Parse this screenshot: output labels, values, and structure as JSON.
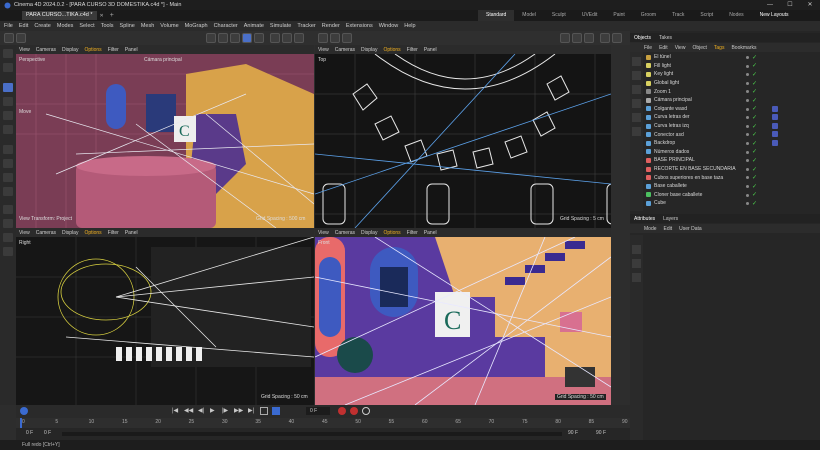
{
  "window": {
    "title": "Cinema 4D 2024.0.2 - [PARA CURSO 3D DOMESTIKA.c4d *] - Main",
    "doc_tab": "PARA CURSO...TIKA.c4d *"
  },
  "layouts": [
    "Standard",
    "Model",
    "Sculpt",
    "UVEdit",
    "Paint",
    "Groom",
    "Track",
    "Script",
    "Nodes",
    "New Layouts"
  ],
  "menu": [
    "File",
    "Edit",
    "Create",
    "Modes",
    "Select",
    "Tools",
    "Spline",
    "Mesh",
    "Volume",
    "MoGraph",
    "Character",
    "Animate",
    "Simulate",
    "Tracker",
    "Render",
    "Extensions",
    "Window",
    "Help"
  ],
  "viewport_menu": [
    "View",
    "Cameras",
    "Display",
    "Options",
    "Filter",
    "Panel"
  ],
  "viewports": {
    "perspective": {
      "label": "Perspective",
      "camera": "Cámara principal",
      "hud": "View Transform: Project",
      "grid": "Grid Spacing : 500 cm"
    },
    "top": {
      "label": "Top",
      "grid": "Grid Spacing : 5 cm"
    },
    "right": {
      "label": "Right",
      "grid": "Grid Spacing : 50 cm"
    },
    "front": {
      "label": "Front",
      "grid": "Grid Spacing : 50 cm"
    }
  },
  "move_label": "Move",
  "timeline": {
    "ticks": [
      "0",
      "5",
      "10",
      "15",
      "20",
      "25",
      "30",
      "35",
      "40",
      "45",
      "50",
      "55",
      "60",
      "65",
      "70",
      "75",
      "80",
      "85",
      "90"
    ],
    "frame_current": "0 F",
    "start": "0 F",
    "start2": "0 F",
    "end": "90 F",
    "end2": "90 F",
    "frame_field": "0 F"
  },
  "status": "Full redo [Ctrl+Y]",
  "objects_panel": {
    "tabs": [
      "Objects",
      "Takes"
    ],
    "menu": [
      "File",
      "Edit",
      "View",
      "Object",
      "Tags",
      "Bookmarks"
    ],
    "items": [
      {
        "name": "El túnel",
        "color": "#c8a040"
      },
      {
        "name": "Fill light",
        "color": "#d8d060"
      },
      {
        "name": "Key light",
        "color": "#d8d060"
      },
      {
        "name": "Global light",
        "color": "#d8d060"
      },
      {
        "name": "Zoom 1",
        "color": "#888"
      },
      {
        "name": "Cámara principal",
        "color": "#aaa"
      },
      {
        "name": "Colgante wasd",
        "color": "#5ba0d8"
      },
      {
        "name": "Curva letras der",
        "color": "#5ba0d8"
      },
      {
        "name": "Curva letras izq",
        "color": "#5ba0d8"
      },
      {
        "name": "Conector asd",
        "color": "#5ba0d8"
      },
      {
        "name": "Backdrop",
        "color": "#5ba0d8"
      },
      {
        "name": "Números dados",
        "color": "#5ba0d8"
      },
      {
        "name": "BASE PRINCIPAL",
        "color": "#e06060"
      },
      {
        "name": "RECORTE EN BASE SECUNDARIA",
        "color": "#e06060"
      },
      {
        "name": "Cubos superiores en base taza",
        "color": "#e06060"
      },
      {
        "name": "Base caballete",
        "color": "#5ba0d8"
      },
      {
        "name": "Cloner base caballete",
        "color": "#4cc060"
      },
      {
        "name": "Cube",
        "color": "#5ba0d8"
      }
    ]
  },
  "attributes_panel": {
    "tabs": [
      "Attributes",
      "Layers"
    ],
    "menu": [
      "Mode",
      "Edit",
      "User Data"
    ]
  },
  "chart_colors": {
    "accent": "#f0b020",
    "check": "#4ccf4c",
    "selection": "#3b6fd6"
  }
}
